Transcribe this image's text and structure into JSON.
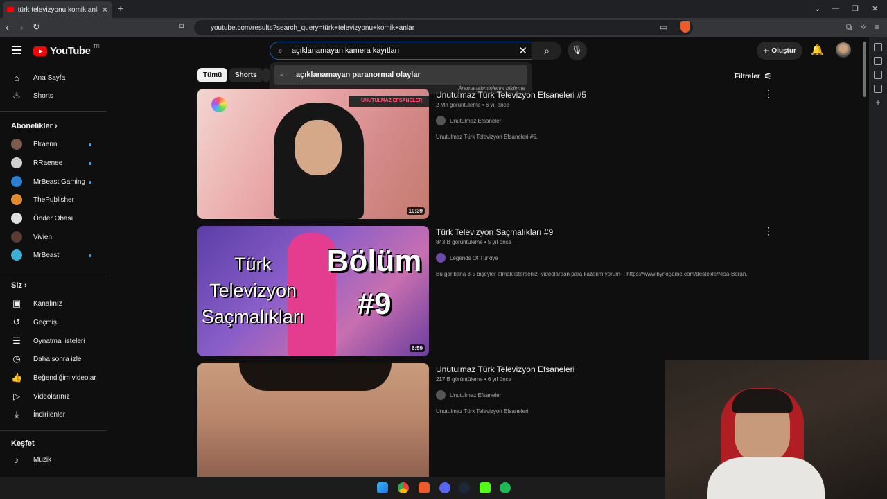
{
  "browser": {
    "tab_title": "türk televizyonu komik anlar - Yo",
    "url": "youtube.com/results?search_query=türk+televizyonu+komik+anlar"
  },
  "header": {
    "logo": "YouTube",
    "logo_region": "TR",
    "search_value": "açıklanamayan kamera kayıtları",
    "create_label": "Oluştur"
  },
  "suggestions": {
    "items": [
      "açıklanamayan paranormal olaylar"
    ],
    "report_note": "Arama tahminlerini bildirme"
  },
  "sidebar": {
    "main": [
      {
        "label": "Ana Sayfa",
        "icon": "home-icon"
      },
      {
        "label": "Shorts",
        "icon": "shorts-icon"
      }
    ],
    "subs_heading": "Abonelikler",
    "subscriptions": [
      {
        "label": "Elraenn",
        "color": "#7a5a48",
        "new": true
      },
      {
        "label": "RRaenee",
        "color": "#cfcfcf",
        "new": true
      },
      {
        "label": "MrBeast Gaming",
        "color": "#2d7fd3",
        "new": true
      },
      {
        "label": "ThePublisher",
        "color": "#e58a2b",
        "new": false
      },
      {
        "label": "Önder Obası",
        "color": "#e0e0e0",
        "new": false
      },
      {
        "label": "Vivien",
        "color": "#5a3d30",
        "new": false
      },
      {
        "label": "MrBeast",
        "color": "#3ab0d6",
        "new": true
      }
    ],
    "you_heading": "Siz",
    "you_items": [
      {
        "label": "Kanalınız",
        "icon": "channel-icon"
      },
      {
        "label": "Geçmiş",
        "icon": "history-icon"
      },
      {
        "label": "Oynatma listeleri",
        "icon": "playlist-icon"
      },
      {
        "label": "Daha sonra izle",
        "icon": "clock-icon"
      },
      {
        "label": "Beğendiğim videolar",
        "icon": "like-icon"
      },
      {
        "label": "Videolarınız",
        "icon": "video-icon"
      },
      {
        "label": "İndirilenler",
        "icon": "download-icon"
      }
    ],
    "explore_heading": "Keşfet",
    "explore_items": [
      {
        "label": "Müzik",
        "icon": "music-icon"
      }
    ]
  },
  "chips": {
    "all": "Tümü",
    "shorts": "Shorts",
    "filters": "Filtreler"
  },
  "videos": [
    {
      "title": "Unutulmaz Türk Televizyon Efsaneleri #5",
      "meta": "2 Mn görüntüleme • 6 yıl önce",
      "channel": "Unutulmaz Efsaneler",
      "desc": "Unutulmaz Türk Televizyon Efsaneleri #5.",
      "duration": "10:39",
      "thumb_caption": "UNUTULMAZ EFSANELER"
    },
    {
      "title": "Türk Televizyon Saçmalıkları #9",
      "meta": "843 B görüntüleme • 5 yıl önce",
      "channel": "Legends Of Türkiye",
      "desc": "Bu garibana 3-5 bişeyler atmak isterseniz -videolardan para kazanmıyorum- : https://www.bynogame.com/destekle/Nisa-Boran.",
      "duration": "6:59",
      "thumb_text_left": "Türk Televizyon Saçmalıkları",
      "thumb_text_right": "Bölüm #9"
    },
    {
      "title": "Unutulmaz Türk Televizyon Efsaneleri",
      "meta": "217 B görüntüleme • 6 yıl önce",
      "channel": "Unutulmaz Efsaneler",
      "desc": "Unutulmaz Türk Televizyon Efsaneleri."
    }
  ]
}
